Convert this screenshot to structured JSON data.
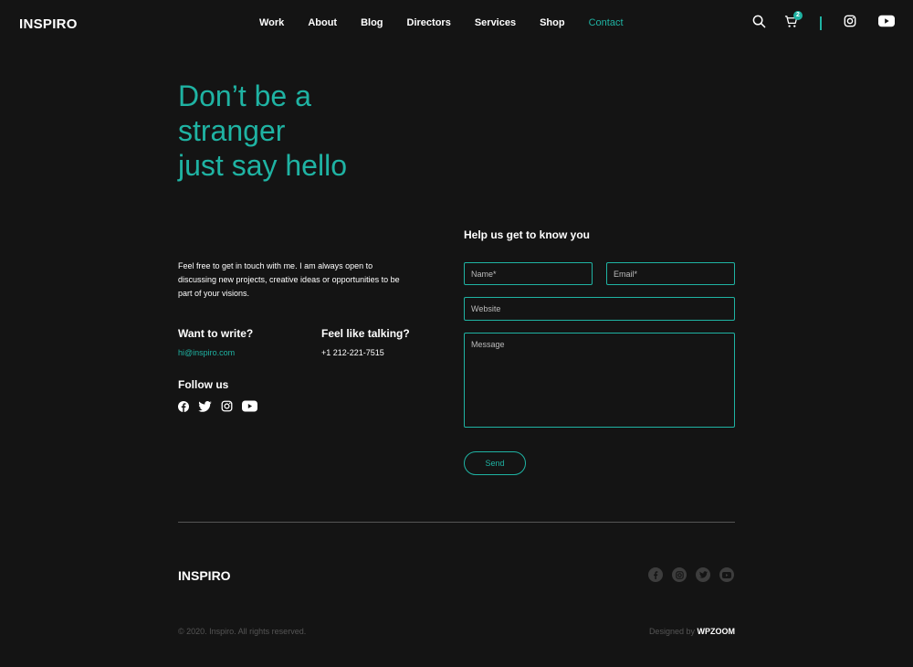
{
  "header": {
    "logo": "INSPIRO",
    "nav": [
      "Work",
      "About",
      "Blog",
      "Directors",
      "Services",
      "Shop",
      "Contact"
    ],
    "active_nav": "Contact",
    "cart_count": "2"
  },
  "hero": {
    "lines": [
      "Don’t be a",
      "stranger",
      "just say hello"
    ]
  },
  "contact_info": {
    "intro": "Feel free to get in touch with me. I am always open to discussing new projects, creative ideas or opportunities to be part of your visions.",
    "write_label": "Want to write?",
    "email": "hi@inspiro.com",
    "talk_label": "Feel like talking?",
    "phone": "+1 212-221-7515",
    "follow_label": "Follow us"
  },
  "form": {
    "title": "Help us get to know you",
    "name_placeholder": "Name*",
    "email_placeholder": "Email*",
    "website_placeholder": "Website",
    "message_placeholder": "Message",
    "send_label": "Send"
  },
  "footer": {
    "logo": "INSPIRO",
    "copyright": "© 2020. Inspiro. All rights reserved.",
    "credit_prefix": "Designed by",
    "credit_brand": "WPZOOM"
  },
  "colors": {
    "accent": "#1fb3a3",
    "background": "#141414"
  }
}
